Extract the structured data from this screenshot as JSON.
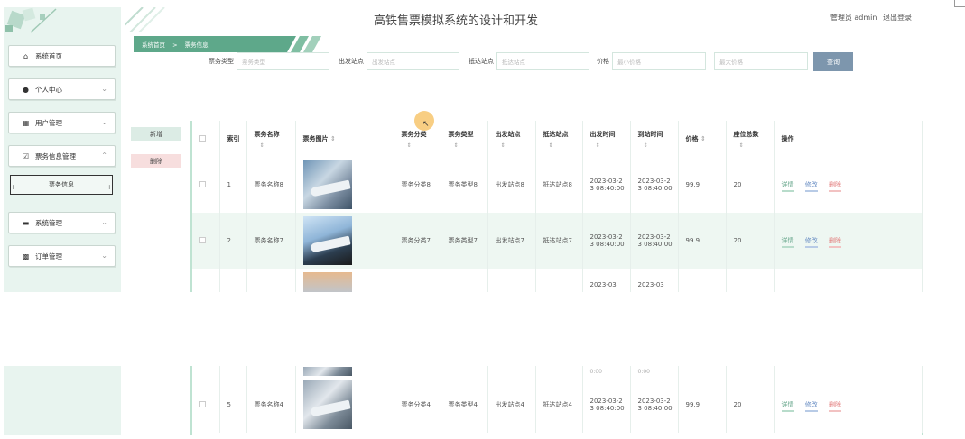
{
  "header": {
    "title": "高铁售票模拟系统的设计和开发",
    "admin_label": "管理员 admin",
    "logout": "退出登录"
  },
  "breadcrumb": [
    "系统首页",
    ">",
    "票务信息"
  ],
  "sidebar": {
    "items": [
      {
        "label": "系统首页",
        "icon": "home-icon"
      },
      {
        "label": "个人中心",
        "icon": "person-icon"
      },
      {
        "label": "用户管理",
        "icon": "grid-icon"
      },
      {
        "label": "票务信息管理",
        "icon": "check-icon"
      },
      {
        "label": "系统管理",
        "icon": "monitor-icon"
      },
      {
        "label": "订单管理",
        "icon": "apps-icon"
      }
    ],
    "submenu": {
      "label": "票务信息"
    }
  },
  "search": {
    "fields": [
      {
        "label": "票务类型",
        "placeholder": "票务类型"
      },
      {
        "label": "出发站点",
        "placeholder": "出发站点"
      },
      {
        "label": "抵达站点",
        "placeholder": "抵达站点"
      },
      {
        "label": "价格",
        "placeholder": "最小价格"
      },
      {
        "label": "",
        "placeholder": "最大价格"
      }
    ],
    "button": "查询"
  },
  "actions": {
    "new": "新增",
    "delete": "删除"
  },
  "table": {
    "headers": [
      "索引",
      "票务名称",
      "票务图片",
      "票务分类",
      "票务类型",
      "出发站点",
      "抵达站点",
      "出发时间",
      "到站时间",
      "价格",
      "座位总数",
      "操作"
    ],
    "sort_glyph": "⇕",
    "row_actions": {
      "detail": "详情",
      "edit": "修改",
      "delete": "删除"
    },
    "rows": [
      {
        "index": "1",
        "name": "票务名称8",
        "category": "票务分类8",
        "type": "票务类型8",
        "from": "出发站点8",
        "to": "抵达站点8",
        "depart": "2023-03-23 08:40:00",
        "arrive": "2023-03-23 08:40:00",
        "price": "99.9",
        "seats": "20"
      },
      {
        "index": "2",
        "name": "票务名称7",
        "category": "票务分类7",
        "type": "票务类型7",
        "from": "出发站点7",
        "to": "抵达站点7",
        "depart": "2023-03-23 08:40:00",
        "arrive": "2023-03-23 08:40:00",
        "price": "99.9",
        "seats": "20"
      },
      {
        "index": "",
        "name": "",
        "category": "",
        "type": "",
        "from": "",
        "to": "",
        "depart": "2023-03",
        "arrive": "2023-03",
        "price": "",
        "seats": ""
      },
      {
        "index": "5",
        "name": "票务名称4",
        "category": "票务分类4",
        "type": "票务类型4",
        "from": "出发站点4",
        "to": "抵达站点4",
        "depart": "2023-03-23 08:40:00",
        "arrive": "2023-03-23 08:40:00",
        "price": "99.9",
        "seats": "20"
      }
    ],
    "partial_times": "0:00"
  }
}
